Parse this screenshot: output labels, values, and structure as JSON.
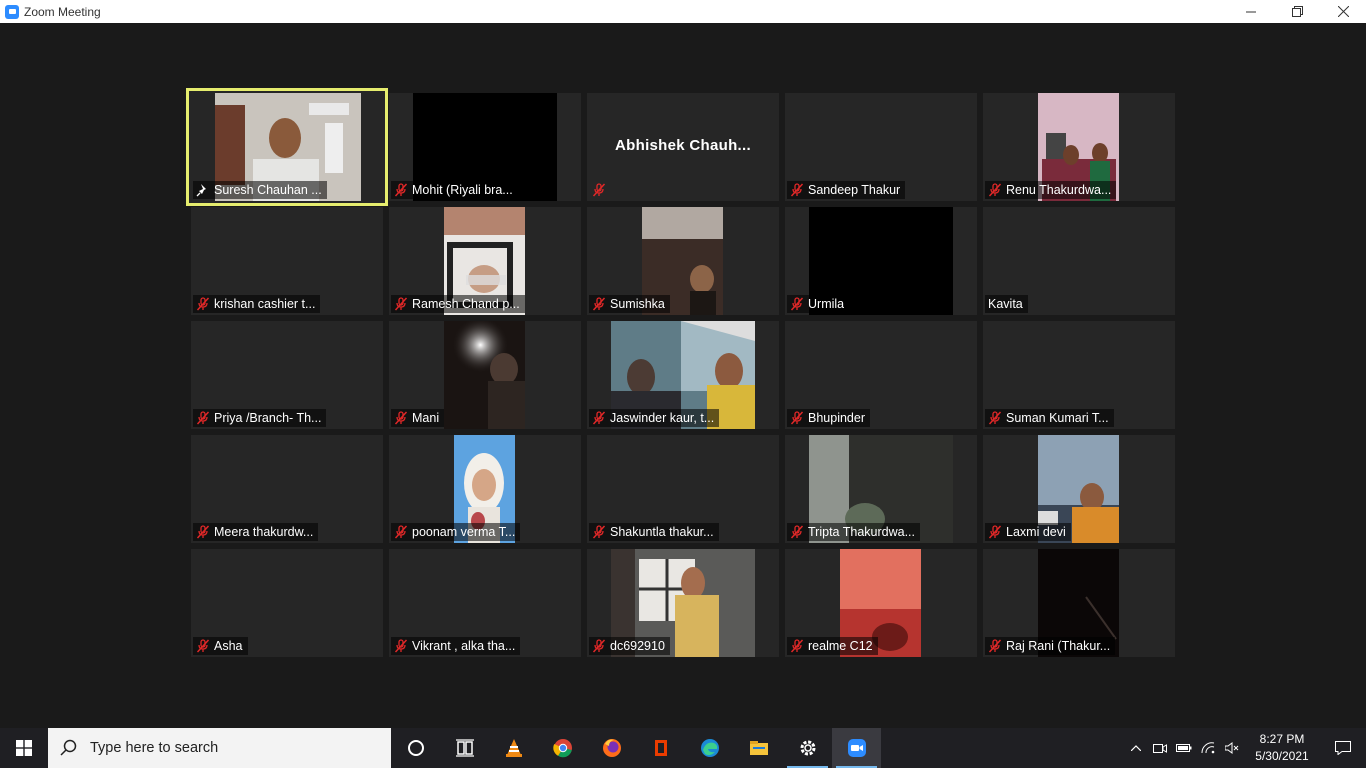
{
  "window": {
    "title": "Zoom Meeting",
    "controls": {
      "minimize": "—",
      "restore": "❐",
      "close": "✕"
    }
  },
  "participants": [
    {
      "name": "Suresh Chauhan ...",
      "active_speaker": true,
      "mic": "pin",
      "video": "room"
    },
    {
      "name": "Mohit (Riyali bra...",
      "mic": "muted",
      "video": "black"
    },
    {
      "name": "",
      "display_name": "Abhishek  Chauh...",
      "mic": "muted",
      "video": "none"
    },
    {
      "name": "Sandeep Thakur",
      "mic": "muted",
      "video": "none"
    },
    {
      "name": "Renu  Thakurdwa...",
      "mic": "muted",
      "video": "pink-room"
    },
    {
      "name": "krishan cashier t...",
      "mic": "muted",
      "video": "none"
    },
    {
      "name": "Ramesh Chand p...",
      "mic": "muted",
      "video": "ceiling"
    },
    {
      "name": "Sumishka",
      "mic": "muted",
      "video": "dim-ceiling"
    },
    {
      "name": "Urmila",
      "mic": "muted",
      "video": "black"
    },
    {
      "name": "Kavita",
      "mic": "none",
      "video": "none"
    },
    {
      "name": "Priya /Branch- Th...",
      "mic": "muted",
      "video": "none"
    },
    {
      "name": "Mani",
      "mic": "muted",
      "video": "lamp"
    },
    {
      "name": "Jaswinder kaur, t...",
      "mic": "muted",
      "video": "blue-room"
    },
    {
      "name": "Bhupinder",
      "mic": "muted",
      "video": "none"
    },
    {
      "name": "Suman Kumari T...",
      "mic": "muted",
      "video": "none"
    },
    {
      "name": "Meera thakurdw...",
      "mic": "muted",
      "video": "none"
    },
    {
      "name": "poonam verma T...",
      "mic": "muted",
      "video": "portrait"
    },
    {
      "name": "Shakuntla thakur...",
      "mic": "muted",
      "video": "none"
    },
    {
      "name": "Tripta Thakurdwa...",
      "mic": "muted",
      "video": "grey-room"
    },
    {
      "name": "Laxmi devi",
      "mic": "muted",
      "video": "orange"
    },
    {
      "name": "Asha",
      "mic": "muted",
      "video": "none"
    },
    {
      "name": "Vikrant , alka tha...",
      "mic": "muted",
      "video": "none"
    },
    {
      "name": "dc692910",
      "mic": "muted",
      "video": "window"
    },
    {
      "name": "realme C12",
      "mic": "muted",
      "video": "red-room"
    },
    {
      "name": "Raj Rani (Thakur...",
      "mic": "muted",
      "video": "dark"
    }
  ],
  "taskbar": {
    "search_placeholder": "Type here to search",
    "apps": [
      "cortana-icon",
      "task-view-icon",
      "vlc-icon",
      "chrome-icon",
      "firefox-icon",
      "office-icon",
      "edge-icon",
      "file-explorer-icon",
      "settings-icon",
      "zoom-icon"
    ],
    "clock": {
      "time": "8:27 PM",
      "date": "5/30/2021"
    }
  },
  "colors": {
    "accent_active_speaker": "#e6ed6e",
    "muted_red": "#e02828",
    "zoom_blue": "#2d8cff",
    "tile_bg": "#262626",
    "stage_bg": "#1a1a1a"
  }
}
